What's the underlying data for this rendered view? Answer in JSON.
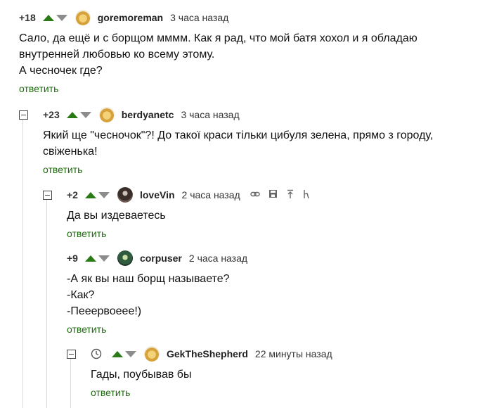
{
  "comments": [
    {
      "rating": "+18",
      "nick": "goremoreman",
      "time": "3 часа назад",
      "text": "Сало, да ещё и с борщом мммм. Как я рад, что мой батя хохол и я обладаю внутренней любовью ко всему этому.\nА чесночек где?",
      "reply": "ответить"
    },
    {
      "rating": "+23",
      "nick": "berdyanetc",
      "time": "3 часа назад",
      "text": "Який ще \"чесночок\"?! До такої краси тільки цибуля зелена, прямо з городу, свіженька!",
      "reply": "ответить"
    },
    {
      "rating": "+2",
      "nick": "loveVin",
      "time": "2 часа назад",
      "text": "Да вы издеваетесь",
      "reply": "ответить"
    },
    {
      "rating": "+9",
      "nick": "corpuser",
      "time": "2 часа назад",
      "text": "-А як вы наш борщ называете?\n-Как?\n-Пееервоеее!)",
      "reply": "ответить"
    },
    {
      "rating": "",
      "nick": "GekTheShepherd",
      "time": "22 минуты назад",
      "text": "Гады, поубывав бы",
      "reply": "ответить"
    }
  ],
  "icons": {
    "link": "link-icon",
    "save": "save-icon",
    "go_to_parent": "go-to-parent-icon",
    "branch": "branch-icon",
    "time_machine": "clock-icon"
  },
  "colors": {
    "upvote": "#2a7a16",
    "downvote": "#8c8c8c",
    "reply_link": "#1f6b0f",
    "thread_line": "#d9d9d9"
  }
}
